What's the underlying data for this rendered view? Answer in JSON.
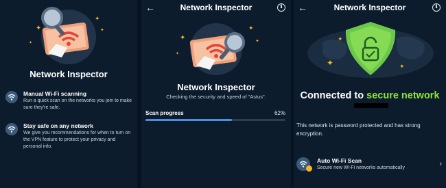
{
  "panel1": {
    "title": "Network Inspector",
    "features": [
      {
        "title": "Manual Wi-Fi scanning",
        "description": "Run a quick scan on the networks you join to make sure they're safe."
      },
      {
        "title": "Stay safe on any network",
        "description": "We give you recommendations for when to turn on the VPN feature to protect your privacy and personal info."
      }
    ]
  },
  "panel2": {
    "nav_title": "Network Inspector",
    "title": "Network Inspector",
    "subtitle": "Checking the security and speed of \"Astus\".",
    "progress_label": "Scan progress",
    "progress_text": "62%",
    "progress_value": 0.62
  },
  "panel3": {
    "nav_title": "Network Inspector",
    "connected_prefix": "Connected to ",
    "connected_accent": "secure network",
    "protect_text": "This network is password protected and has strong encryption.",
    "auto_title": "Auto Wi-Fi Scan",
    "auto_desc": "Secure new Wi-Fi networks automatically"
  },
  "icons": {
    "back": "arrow-left",
    "info": "info-circle",
    "wifi": "wifi",
    "lock": "lock",
    "chevron": "chevron-right"
  },
  "colors": {
    "background": "#0c1c2d",
    "accent_green": "#8ee33b",
    "progress_blue": "#4a90e2",
    "star_yellow": "#f2b824"
  }
}
